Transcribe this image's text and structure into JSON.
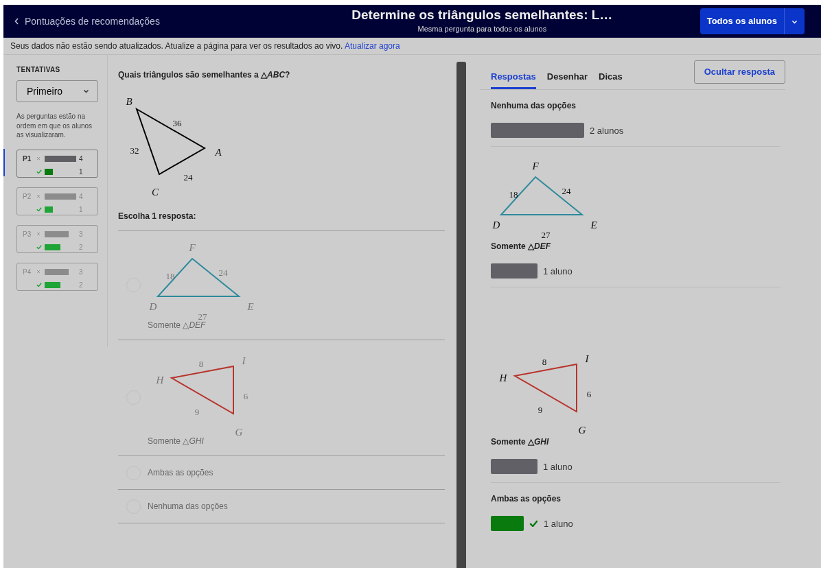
{
  "header": {
    "back_link": "Pontuações de recomendações",
    "title": "Determine os triângulos semelhantes: L…",
    "subtitle": "Mesma pergunta para todos os alunos",
    "student_filter": "Todos os alunos"
  },
  "notice": {
    "text": "Seus dados não estão sendo atualizados. Atualize a página para ver os resultados ao vivo.",
    "link": "Atualizar agora"
  },
  "sidebar": {
    "heading": "TENTATIVAS",
    "attempt_select": "Primeiro",
    "note": "As perguntas estão na ordem em que os alunos as visualizaram.",
    "questions": [
      {
        "label": "P1",
        "selected": true,
        "wrong": {
          "count": "4"
        },
        "correct": {
          "count": "1"
        }
      },
      {
        "label": "P2",
        "selected": false,
        "wrong": {
          "count": "4"
        },
        "correct": {
          "count": "1"
        }
      },
      {
        "label": "P3",
        "selected": false,
        "wrong": {
          "count": "3"
        },
        "correct": {
          "count": "2"
        }
      },
      {
        "label": "P4",
        "selected": false,
        "wrong": {
          "count": "3"
        },
        "correct": {
          "count": "2"
        }
      }
    ]
  },
  "question": {
    "prompt": "Quais triângulos são semelhantes a △*ABC*?",
    "figure": {
      "kind": "abc",
      "color": "#000000",
      "vertices": [
        "B",
        "A",
        "C"
      ],
      "sides": [
        "36",
        "24",
        "32"
      ]
    },
    "instruction": "Escolha 1 resposta:",
    "options": [
      {
        "selected": false,
        "figure": {
          "kind": "def",
          "color": "#2e8a9c",
          "vertices": [
            "F",
            "E",
            "D"
          ],
          "sides": [
            "24",
            "27",
            "18"
          ]
        },
        "label": "Somente △*DEF*"
      },
      {
        "selected": false,
        "figure": {
          "kind": "ghi",
          "color": "#b8332b",
          "vertices": [
            "I",
            "G",
            "H"
          ],
          "sides": [
            "6",
            "9",
            "8"
          ]
        },
        "label": "Somente △*GHI*"
      },
      {
        "selected": false,
        "label": "Ambas as opções"
      },
      {
        "selected": false,
        "label": "Nenhuma das opções"
      }
    ]
  },
  "results": {
    "tabs": [
      {
        "label": "Respostas",
        "selected": true
      },
      {
        "label": "Desenhar",
        "selected": false
      },
      {
        "label": "Dicas",
        "selected": false
      }
    ],
    "hide_button": "Ocultar resposta",
    "responses": [
      {
        "label": "Nenhuma das opções",
        "correct": false,
        "count": "2 alunos"
      },
      {
        "figure": {
          "kind": "def",
          "color": "#2e8a9c",
          "vertices": [
            "F",
            "E",
            "D"
          ],
          "sides": [
            "24",
            "27",
            "18"
          ]
        },
        "label": "Somente △*DEF*",
        "correct": false,
        "count": "1 aluno"
      },
      {
        "figure": {
          "kind": "ghi",
          "color": "#b8332b",
          "vertices": [
            "I",
            "G",
            "H"
          ],
          "sides": [
            "6",
            "9",
            "8"
          ]
        },
        "label": "Somente △*GHI*",
        "correct": false,
        "count": "1 aluno"
      },
      {
        "label": "Ambas as opções",
        "correct": true,
        "count": "1 aluno"
      }
    ]
  }
}
